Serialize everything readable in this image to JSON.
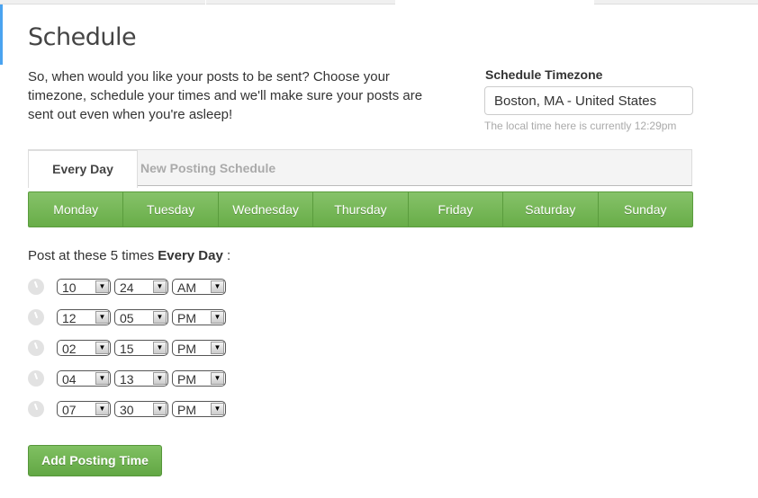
{
  "title": "Schedule",
  "intro": "So, when would you like your posts to be sent? Choose your timezone, schedule your times and we'll make sure your posts are sent out even when you're asleep!",
  "timezone": {
    "label": "Schedule Timezone",
    "value": "Boston, MA - United States",
    "hint": "The local time here is currently 12:29pm"
  },
  "tabs": [
    {
      "label": "Every Day",
      "active": true
    },
    {
      "label": "New Posting Schedule",
      "active": false
    }
  ],
  "days": [
    "Monday",
    "Tuesday",
    "Wednesday",
    "Thursday",
    "Friday",
    "Saturday",
    "Sunday"
  ],
  "post": {
    "prefix": "Post at these 5 times ",
    "bold": "Every Day",
    "suffix": " :"
  },
  "times": [
    {
      "hour": "10",
      "minute": "24",
      "ampm": "AM"
    },
    {
      "hour": "12",
      "minute": "05",
      "ampm": "PM"
    },
    {
      "hour": "02",
      "minute": "15",
      "ampm": "PM"
    },
    {
      "hour": "04",
      "minute": "13",
      "ampm": "PM"
    },
    {
      "hour": "07",
      "minute": "30",
      "ampm": "PM"
    }
  ],
  "add_button": "Add Posting Time",
  "colors": {
    "accent_green": "#6cb14c",
    "left_bar": "#4aa3f0"
  }
}
